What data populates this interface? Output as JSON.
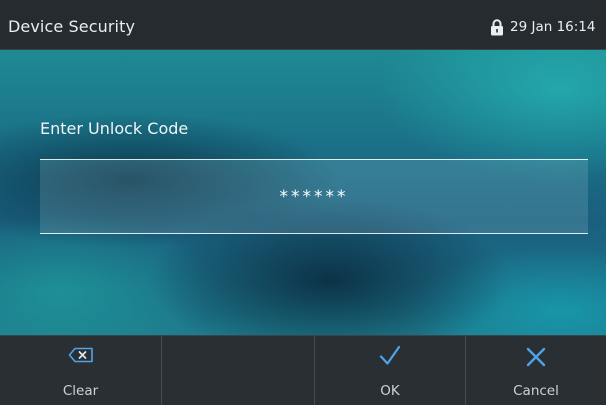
{
  "header": {
    "title": "Device Security",
    "datetime": "29 Jan 16:14",
    "lock_icon": "lock-icon"
  },
  "main": {
    "prompt": "Enter Unlock Code",
    "code_value": "******"
  },
  "softkeys": [
    {
      "label": "Clear",
      "icon": "backspace-icon"
    },
    {
      "label": "",
      "icon": ""
    },
    {
      "label": "OK",
      "icon": "checkmark-icon"
    },
    {
      "label": "Cancel",
      "icon": "close-icon"
    }
  ],
  "colors": {
    "accent": "#4fa3e8",
    "header_bg": "#262b30",
    "softkey_bg": "#2a2f34"
  }
}
